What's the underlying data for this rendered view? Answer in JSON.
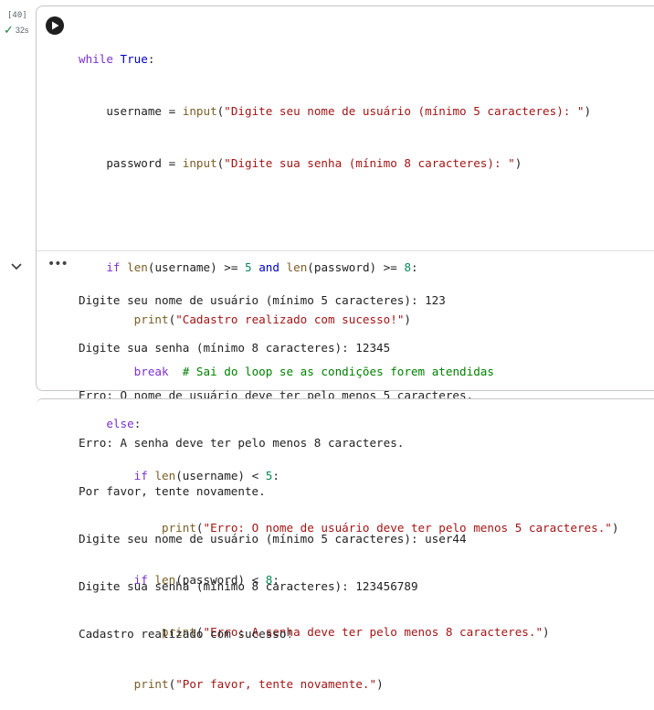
{
  "cell": {
    "execution_count": "[40]",
    "duration": "32s",
    "run_icon": "play-icon",
    "status_icon": "checkmark-icon"
  },
  "code": {
    "l1": {
      "a": "while",
      "b": " ",
      "c": "True",
      "d": ":"
    },
    "l2": {
      "a": "    username = ",
      "b": "input",
      "c": "(",
      "d": "\"Digite seu nome de usuário (mínimo 5 caracteres): \"",
      "e": ")"
    },
    "l3": {
      "a": "    password = ",
      "b": "input",
      "c": "(",
      "d": "\"Digite sua senha (mínimo 8 caracteres): \"",
      "e": ")"
    },
    "l5": {
      "a": "    ",
      "b": "if",
      "c": " ",
      "d": "len",
      "e": "(username) >= ",
      "f": "5",
      "g": " ",
      "h": "and",
      "i": " ",
      "j": "len",
      "k": "(password) >= ",
      "l": "8",
      "m": ":"
    },
    "l6": {
      "a": "        ",
      "b": "print",
      "c": "(",
      "d": "\"Cadastro realizado com sucesso!\"",
      "e": ")"
    },
    "l7": {
      "a": "        ",
      "b": "break",
      "c": "  ",
      "d": "# Sai do loop se as condições forem atendidas"
    },
    "l8": {
      "a": "    ",
      "b": "else",
      "c": ":"
    },
    "l9": {
      "a": "        ",
      "b": "if",
      "c": " ",
      "d": "len",
      "e": "(username) < ",
      "f": "5",
      "g": ":"
    },
    "l10": {
      "a": "            ",
      "b": "print",
      "c": "(",
      "d": "\"Erro: O nome de usuário deve ter pelo menos 5 caracteres.\"",
      "e": ")"
    },
    "l11": {
      "a": "        ",
      "b": "if",
      "c": " ",
      "d": "len",
      "e": "(password) < ",
      "f": "8",
      "g": ":"
    },
    "l12": {
      "a": "            ",
      "b": "print",
      "c": "(",
      "d": "\"Erro: A senha deve ter pelo menos 8 caracteres.\"",
      "e": ")"
    },
    "l13": {
      "a": "        ",
      "b": "print",
      "c": "(",
      "d": "\"Por favor, tente novamente.\"",
      "e": ")"
    }
  },
  "output": {
    "collapse_icon": "chevron-down-icon",
    "menu_icon": "more-horizontal-icon",
    "lines": [
      "Digite seu nome de usuário (mínimo 5 caracteres): 123",
      "Digite sua senha (mínimo 8 caracteres): 12345",
      "Erro: O nome de usuário deve ter pelo menos 5 caracteres.",
      "Erro: A senha deve ter pelo menos 8 caracteres.",
      "Por favor, tente novamente.",
      "Digite seu nome de usuário (mínimo 5 caracteres): user44",
      "Digite sua senha (mínimo 8 caracteres): 123456789",
      "Cadastro realizado com sucesso!"
    ]
  },
  "colors": {
    "keyword": "#7b30d0",
    "keyword_bool": "#0000c9",
    "function": "#795e26",
    "string": "#a31515",
    "number": "#09885a",
    "comment": "#008000",
    "success": "#188038"
  }
}
